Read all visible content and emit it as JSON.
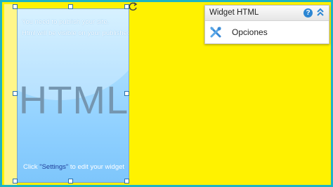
{
  "widget": {
    "message_line1": "You need to publish your site.",
    "message_line2": "Html will be visible on your published site",
    "big_label": "HTML",
    "footer_before": "Click ",
    "footer_link": "\"Settings\"",
    "footer_after": " to edit your widget"
  },
  "panel": {
    "title": "Widget HTML",
    "help_glyph": "?",
    "item_label": "Opciones",
    "icons": [
      "help-icon",
      "collapse-up-icon",
      "tools-icon"
    ]
  },
  "colors": {
    "background": "#fff200",
    "frame_border": "#1eb4c3",
    "widget_blue": "#8fd0ff",
    "accent": "#2b86d3"
  }
}
